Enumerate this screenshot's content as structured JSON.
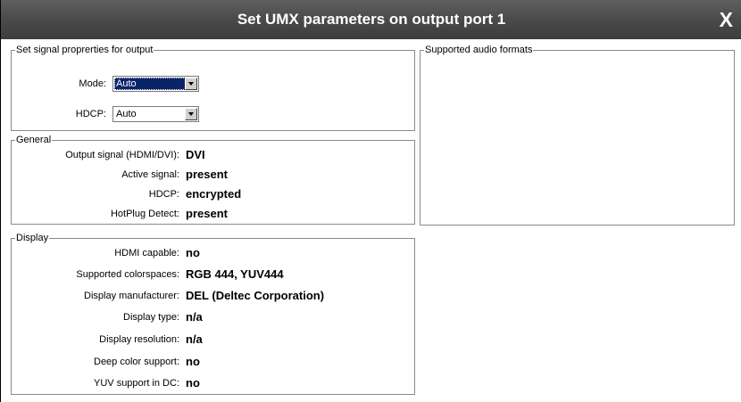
{
  "window": {
    "title": "Set UMX parameters on output port 1",
    "close_label": "X"
  },
  "signal_properties": {
    "legend": "Set signal proprerties for output",
    "mode_label": "Mode:",
    "mode_value": "Auto",
    "hdcp_label": "HDCP:",
    "hdcp_value": "Auto"
  },
  "audio": {
    "legend": "Supported audio formats"
  },
  "general": {
    "legend": "General",
    "rows": [
      {
        "label": "Output signal (HDMI/DVI):",
        "value": "DVI"
      },
      {
        "label": "Active signal:",
        "value": "present"
      },
      {
        "label": "HDCP:",
        "value": "encrypted"
      },
      {
        "label": "HotPlug Detect:",
        "value": "present"
      }
    ]
  },
  "display": {
    "legend": "Display",
    "rows": [
      {
        "label": "HDMI capable:",
        "value": "no"
      },
      {
        "label": "Supported colorspaces:",
        "value": "RGB 444, YUV444"
      },
      {
        "label": "Display manufacturer:",
        "value": "DEL (Deltec Corporation)"
      },
      {
        "label": "Display type:",
        "value": "n/a"
      },
      {
        "label": "Display resolution:",
        "value": "n/a"
      },
      {
        "label": "Deep color support:",
        "value": "no"
      },
      {
        "label": "YUV support in DC:",
        "value": "no"
      }
    ]
  }
}
